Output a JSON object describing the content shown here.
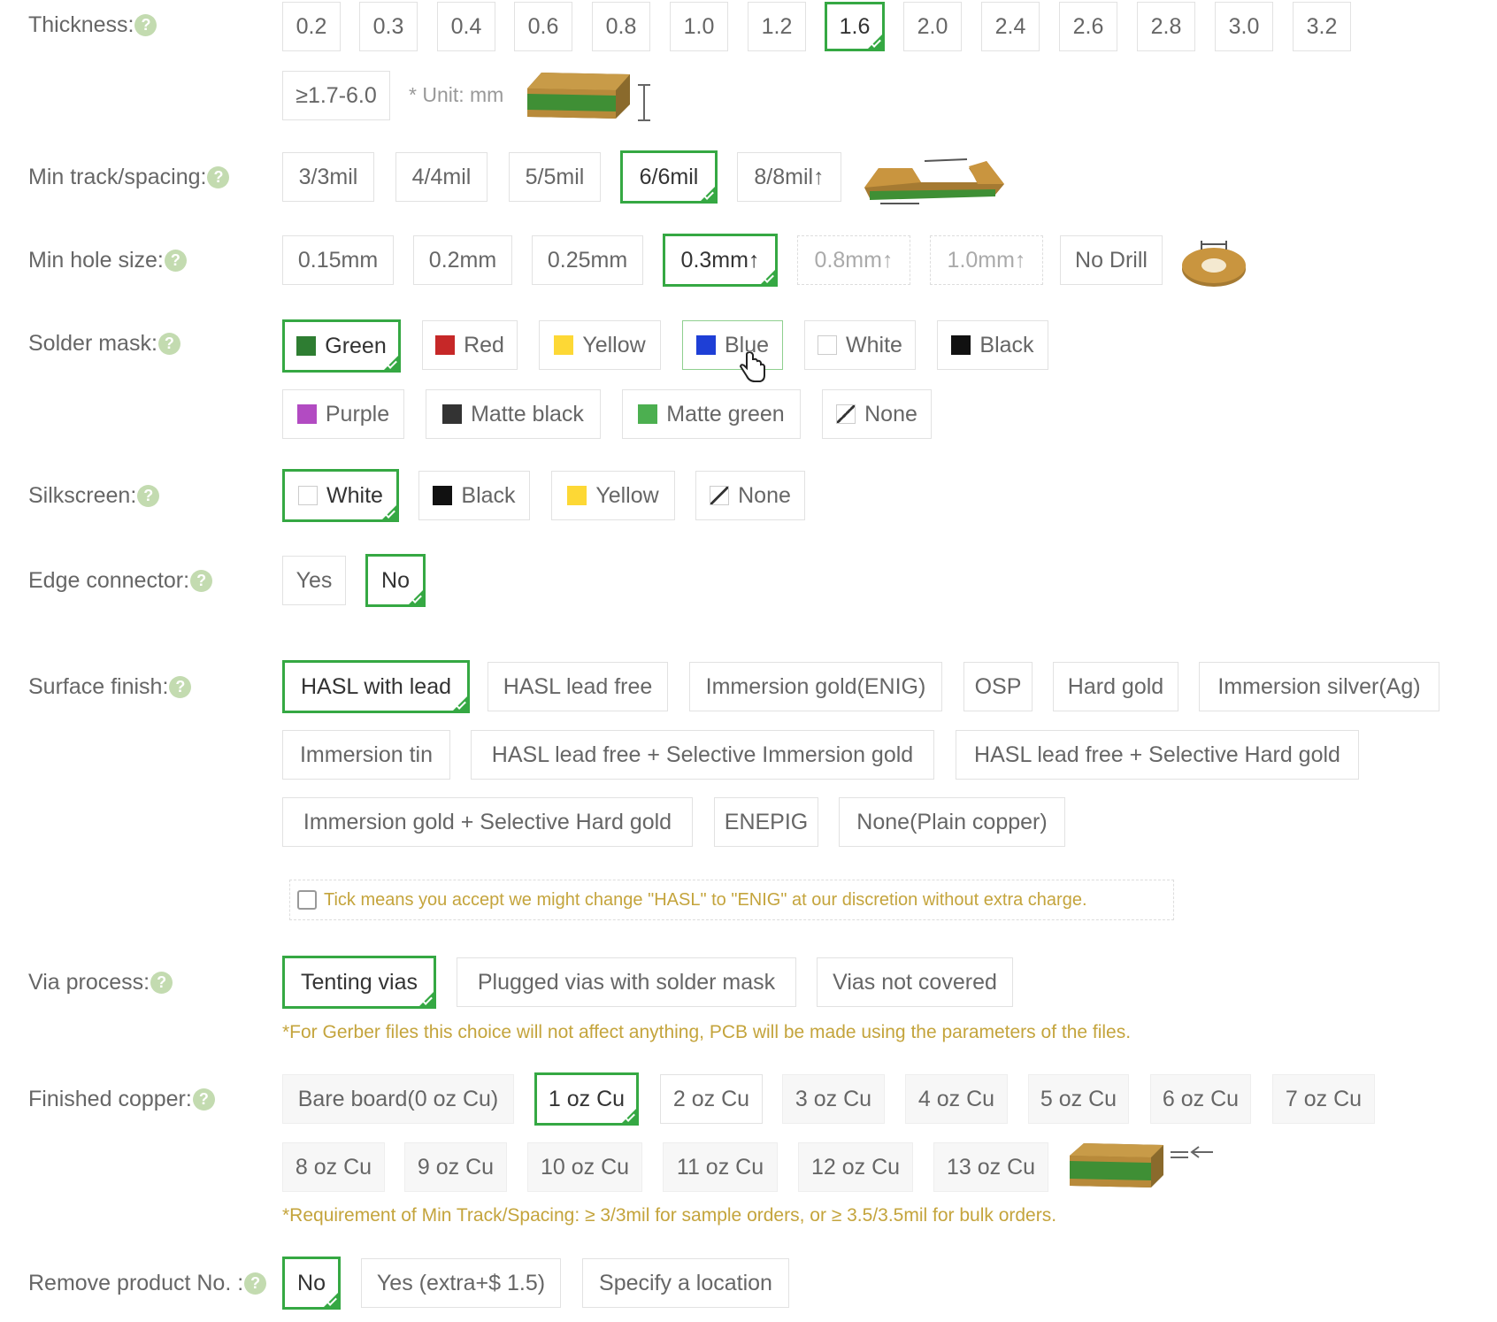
{
  "thickness": {
    "label": "Thickness:",
    "options": [
      "0.2",
      "0.3",
      "0.4",
      "0.6",
      "0.8",
      "1.0",
      "1.2",
      "1.6",
      "2.0",
      "2.4",
      "2.6",
      "2.8",
      "3.0",
      "3.2"
    ],
    "extra": "≥1.7-6.0",
    "unit_note": "* Unit: mm",
    "selected": "1.6"
  },
  "min_track": {
    "label": "Min track/spacing:",
    "options": [
      "3/3mil",
      "4/4mil",
      "5/5mil",
      "6/6mil",
      "8/8mil↑"
    ],
    "selected": "6/6mil"
  },
  "min_hole": {
    "label": "Min hole size:",
    "options": [
      "0.15mm",
      "0.2mm",
      "0.25mm",
      "0.3mm↑",
      "0.8mm↑",
      "1.0mm↑",
      "No Drill"
    ],
    "selected": "0.3mm↑"
  },
  "solder_mask": {
    "label": "Solder mask:",
    "options": [
      {
        "name": "Green",
        "color": "#2e7d32"
      },
      {
        "name": "Red",
        "color": "#c62828"
      },
      {
        "name": "Yellow",
        "color": "#fdd835"
      },
      {
        "name": "Blue",
        "color": "#1e3fd6"
      },
      {
        "name": "White",
        "color": "#ffffff"
      },
      {
        "name": "Black",
        "color": "#111111"
      },
      {
        "name": "Purple",
        "color": "#b24bc2"
      },
      {
        "name": "Matte black",
        "color": "#333333"
      },
      {
        "name": "Matte green",
        "color": "#4caf50"
      },
      {
        "name": "None",
        "color": "none"
      }
    ],
    "selected": "Green"
  },
  "silkscreen": {
    "label": "Silkscreen:",
    "options": [
      {
        "name": "White",
        "color": "#ffffff"
      },
      {
        "name": "Black",
        "color": "#111111"
      },
      {
        "name": "Yellow",
        "color": "#fdd835"
      },
      {
        "name": "None",
        "color": "none"
      }
    ],
    "selected": "White"
  },
  "edge_connector": {
    "label": "Edge connector:",
    "options": [
      "Yes",
      "No"
    ],
    "selected": "No"
  },
  "surface_finish": {
    "label": "Surface finish:",
    "options": [
      "HASL with lead",
      "HASL lead free",
      "Immersion gold(ENIG)",
      "OSP",
      "Hard gold",
      "Immersion silver(Ag)",
      "Immersion tin",
      "HASL lead free + Selective Immersion gold",
      "HASL lead free + Selective Hard gold",
      "Immersion gold + Selective Hard gold",
      "ENEPIG",
      "None(Plain copper)"
    ],
    "selected": "HASL with lead",
    "tick_note": "Tick means you accept we might change \"HASL\" to \"ENIG\" at our discretion without extra charge."
  },
  "via_process": {
    "label": "Via process:",
    "options": [
      "Tenting vias",
      "Plugged vias with solder mask",
      "Vias not covered"
    ],
    "selected": "Tenting vias",
    "note": "*For Gerber files this choice will not affect anything, PCB will be made using the parameters of the files."
  },
  "finished_copper": {
    "label": "Finished copper:",
    "options": [
      "Bare board(0 oz Cu)",
      "1 oz Cu",
      "2 oz Cu",
      "3 oz Cu",
      "4 oz Cu",
      "5 oz Cu",
      "6 oz Cu",
      "7 oz Cu",
      "8 oz Cu",
      "9 oz Cu",
      "10 oz Cu",
      "11 oz Cu",
      "12 oz Cu",
      "13 oz Cu"
    ],
    "selected": "1 oz Cu",
    "note": "*Requirement of Min Track/Spacing: ≥ 3/3mil for sample orders, or ≥ 3.5/3.5mil for bulk orders."
  },
  "remove_product_no": {
    "label": "Remove product No. :",
    "options": [
      "No",
      "Yes (extra+$ 1.5)",
      "Specify a location"
    ],
    "selected": "No"
  },
  "help_icon_text": "?",
  "colors": {
    "accent": "#35a843",
    "note": "#c4a43c",
    "label": "#666666"
  }
}
